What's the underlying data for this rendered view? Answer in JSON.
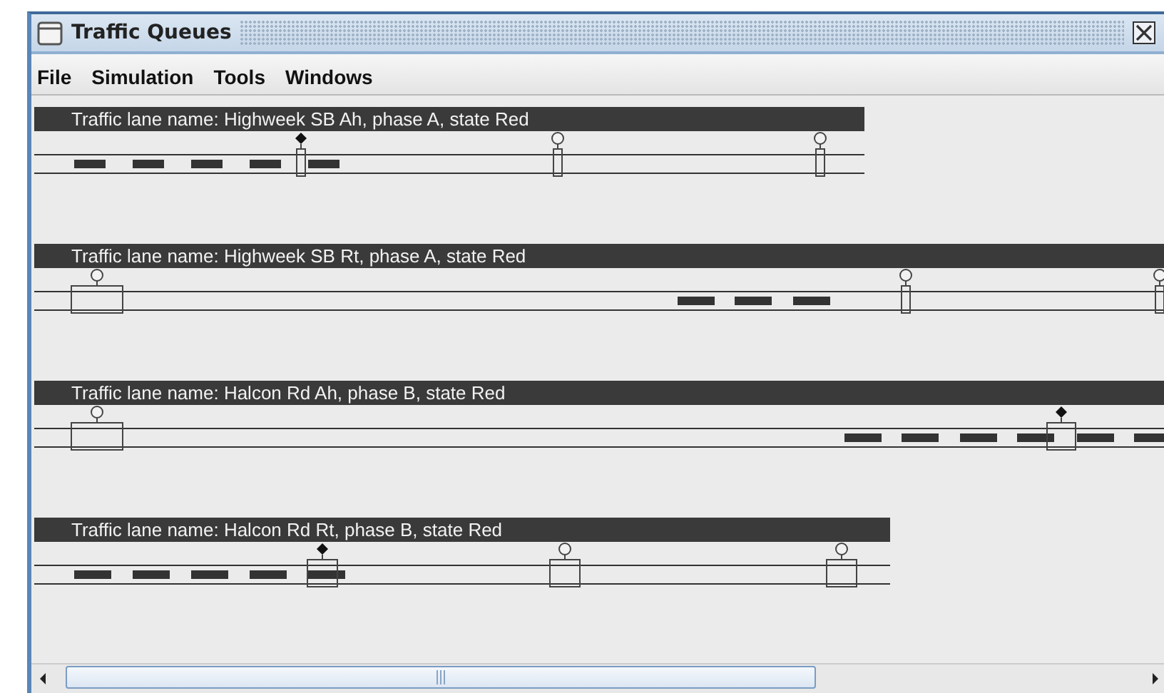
{
  "window": {
    "title": "Traffic Queues"
  },
  "menu": [
    "File",
    "Simulation",
    "Tools",
    "Windows"
  ],
  "lanes": [
    {
      "label": "Traffic lane name: Highweek SB Ah, phase A, state Red",
      "detectors": [
        {
          "occupied": true
        },
        {
          "occupied": false
        },
        {
          "occupied": false
        }
      ]
    },
    {
      "label": "Traffic lane name: Highweek SB Rt, phase A, state Red",
      "detectors": [
        {
          "occupied": false
        },
        {
          "occupied": false
        },
        {
          "occupied": false
        }
      ]
    },
    {
      "label": "Traffic lane name: Halcon Rd Ah, phase B, state Red",
      "detectors": [
        {
          "occupied": false
        },
        {
          "occupied": true
        }
      ]
    },
    {
      "label": "Traffic lane name: Halcon Rd Rt, phase B, state Red",
      "detectors": [
        {
          "occupied": true
        },
        {
          "occupied": false
        },
        {
          "occupied": false
        }
      ]
    }
  ]
}
